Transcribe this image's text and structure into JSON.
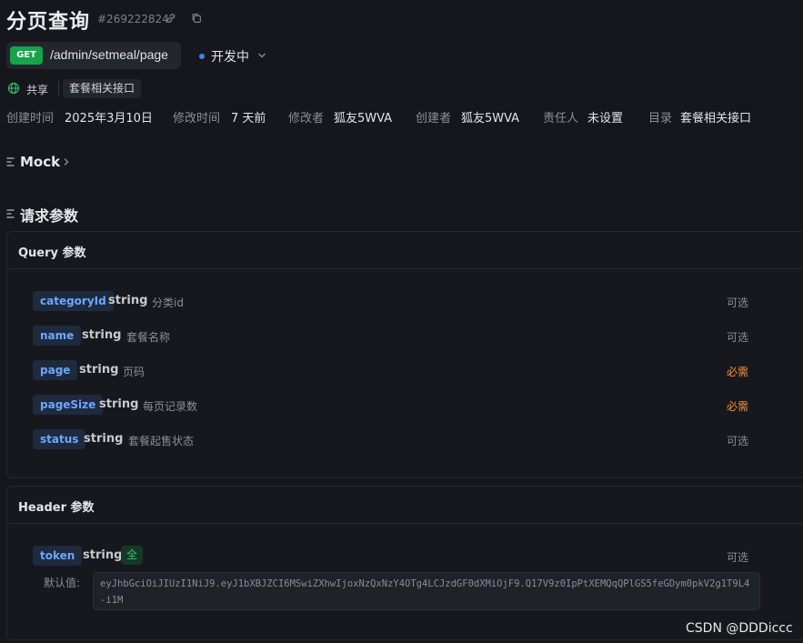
{
  "header": {
    "title": "分页查询",
    "id": "#269222824",
    "icons": [
      "link-icon",
      "copy-icon"
    ]
  },
  "endpoint": {
    "method": "GET",
    "path": "/admin/setmeal/page",
    "status": "开发中",
    "status_color": "#3b82f6",
    "method_color": "#16a34a"
  },
  "share": {
    "label": "共享",
    "tag": "套餐相关接口"
  },
  "meta": {
    "created_time_label": "创建时间",
    "created_time": "2025年3月10日",
    "modified_time_label": "修改时间",
    "modified_time": "7 天前",
    "modifier_label": "修改者",
    "modifier": "狐友5WVA",
    "creator_label": "创建者",
    "creator": "狐友5WVA",
    "owner_label": "责任人",
    "owner": "未设置",
    "directory_label": "目录",
    "directory": "套餐相关接口"
  },
  "mock": {
    "title": "Mock"
  },
  "request_params": {
    "title": "请求参数",
    "query": {
      "title": "Query 参数",
      "params": [
        {
          "name": "categoryId",
          "type": "string",
          "desc": "分类id",
          "req": "可选"
        },
        {
          "name": "name",
          "type": "string",
          "desc": "套餐名称",
          "req": "可选"
        },
        {
          "name": "page",
          "type": "string",
          "desc": "页码",
          "req": "必需"
        },
        {
          "name": "pageSize",
          "type": "string",
          "desc": "每页记录数",
          "req": "必需"
        },
        {
          "name": "status",
          "type": "string",
          "desc": "套餐起售状态",
          "req": "可选"
        }
      ]
    },
    "header": {
      "title": "Header 参数",
      "param": {
        "name": "token",
        "type": "string",
        "badge": "全",
        "req": "可选",
        "default_label": "默认值:",
        "default_value": "eyJhbGciOiJIUzI1NiJ9.eyJ1bXBJZCI6MSwiZXhwIjoxNzQxNzY4OTg4LCJzdGF0dXMiOjF9.Q17V9z0IpPtXEMQqQPlGS5feGDym0pkV2g1T9L4-i1M"
      }
    }
  },
  "watermark": "CSDN @DDDiccc",
  "colors": {
    "required": "#f2913d",
    "param_name": "#6ea6ff",
    "badge_all": "#35c26b"
  }
}
